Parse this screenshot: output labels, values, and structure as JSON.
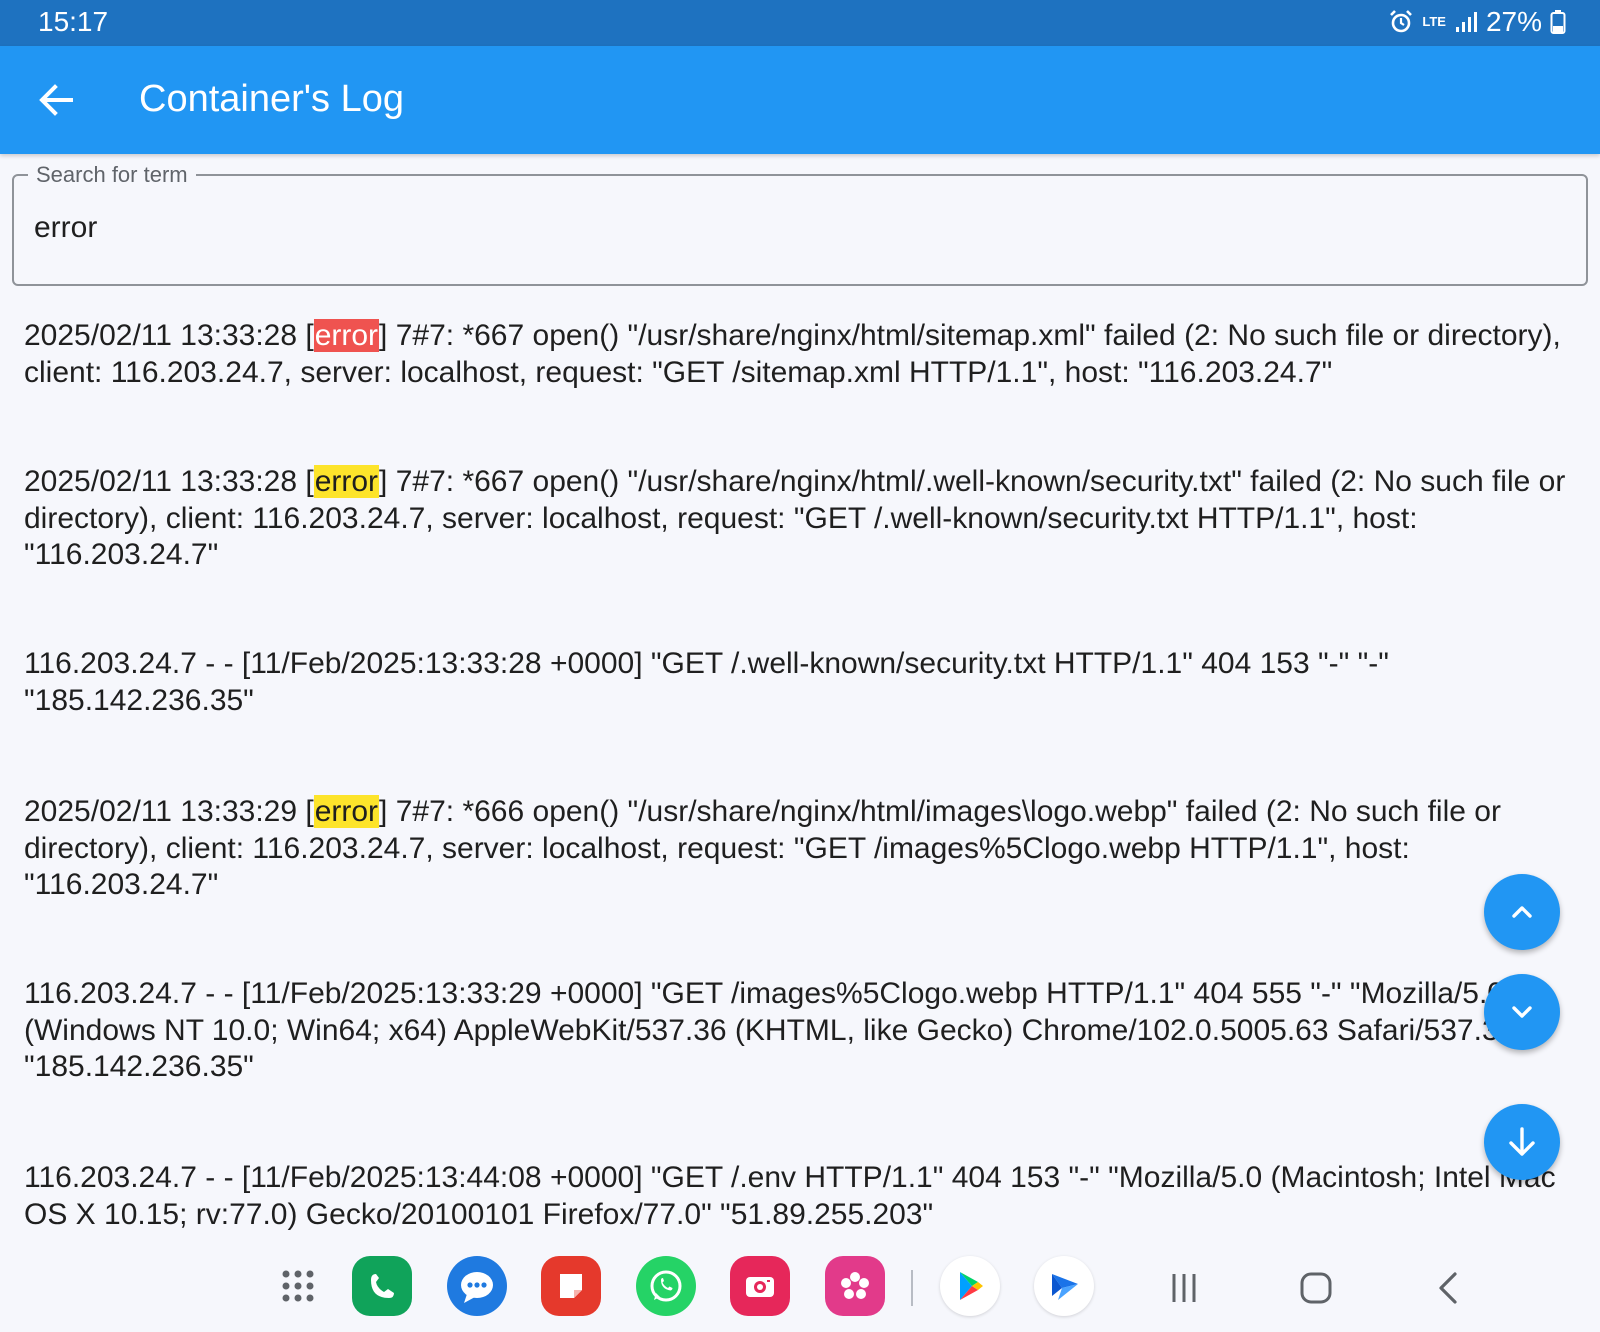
{
  "status_bar": {
    "time": "15:17",
    "network": "LTE",
    "battery": "27%",
    "icons": [
      "alarm-icon",
      "lte-icon",
      "signal-icon",
      "battery-icon"
    ]
  },
  "app_bar": {
    "title": "Container's Log",
    "back_icon": "arrow-back-icon",
    "color": "#2196f3"
  },
  "search": {
    "label": "Search for term",
    "value": "error"
  },
  "highlight_colors": {
    "current": "#ef5350",
    "match": "#fde42b"
  },
  "logs": [
    {
      "before": "2025/02/11 13:33:28 [",
      "match": "error",
      "after": "] 7#7: *667 open() \"/usr/share/nginx/html/sitemap.xml\" failed (2: No such file or directory), client: 116.203.24.7, server: localhost, request: \"GET /sitemap.xml HTTP/1.1\", host: \"116.203.24.7\""
    },
    {
      "before": "2025/02/11 13:33:28 [",
      "match": "error",
      "after": "] 7#7: *667 open() \"/usr/share/nginx/html/.well-known/security.txt\" failed (2: No such file or directory), client: 116.203.24.7, server: localhost, request: \"GET /.well-known/security.txt HTTP/1.1\", host: \"116.203.24.7\""
    },
    {
      "text": "116.203.24.7 - - [11/Feb/2025:13:33:28 +0000] \"GET /.well-known/security.txt HTTP/1.1\" 404 153 \"-\" \"-\" \"185.142.236.35\""
    },
    {
      "before": "2025/02/11 13:33:29 [",
      "match": "error",
      "after": "] 7#7: *666 open() \"/usr/share/nginx/html/images\\logo.webp\" failed (2: No such file or directory), client: 116.203.24.7, server: localhost, request: \"GET /images%5Clogo.webp HTTP/1.1\", host: \"116.203.24.7\""
    },
    {
      "text": "116.203.24.7 - - [11/Feb/2025:13:33:29 +0000] \"GET /images%5Clogo.webp HTTP/1.1\" 404 555 \"-\" \"Mozilla/5.0 (Windows NT 10.0; Win64; x64) AppleWebKit/537.36 (KHTML, like Gecko) Chrome/102.0.5005.63 Safari/537.36\" \"185.142.236.35\""
    },
    {
      "text": "116.203.24.7 - - [11/Feb/2025:13:44:08 +0000] \"GET /.env HTTP/1.1\" 404 153 \"-\" \"Mozilla/5.0 (Macintosh; Intel Mac OS X 10.15; rv:77.0) Gecko/20100101 Firefox/77.0\" \"51.89.255.203\""
    }
  ],
  "fabs": [
    "chevron-up-icon",
    "chevron-down-icon",
    "arrow-down-icon"
  ],
  "taskbar": {
    "apps": [
      {
        "name": "apps-grid-icon",
        "color": "#5f6368"
      },
      {
        "name": "phone-app-icon",
        "color": "#10a35a"
      },
      {
        "name": "messages-app-icon",
        "color": "#1f7ae0"
      },
      {
        "name": "notes-app-icon",
        "color": "#e5392c"
      },
      {
        "name": "whatsapp-app-icon",
        "color": "#25d366"
      },
      {
        "name": "camera-app-icon",
        "color": "#e6275a"
      },
      {
        "name": "gallery-app-icon",
        "color": "#e23a8a"
      },
      {
        "name": "play-store-app-icon",
        "color": "#ffffff"
      },
      {
        "name": "remote-app-icon",
        "color": "#ffffff"
      }
    ],
    "nav": [
      "recents-icon",
      "home-icon",
      "back-nav-icon"
    ]
  }
}
